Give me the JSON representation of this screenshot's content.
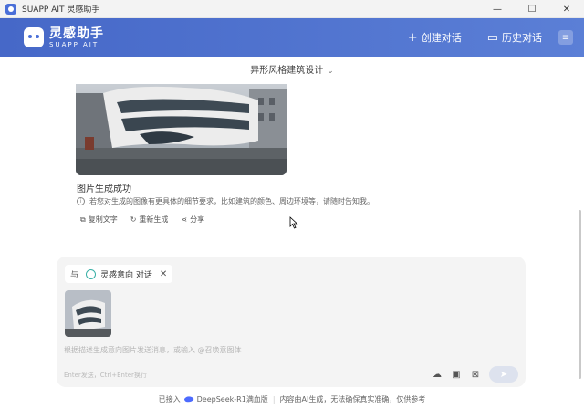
{
  "window": {
    "title": "SUAPP AIT 灵感助手",
    "minimize": "—",
    "maximize": "☐",
    "close": "✕"
  },
  "header": {
    "logo_cn": "灵感助手",
    "logo_en": "SUAPP AIT",
    "new_chat_icon": "+",
    "new_chat": "创建对话",
    "history_icon": "▭",
    "history": "历史对话",
    "menu_icon": "≡"
  },
  "mode": {
    "label": "异形风格建筑设计",
    "caret": "⌄"
  },
  "message": {
    "status": "图片生成成功",
    "hint": "若您对生成的图像有更具体的细节要求，比如建筑的颜色、周边环境等，请随时告知我。",
    "info_icon": "i",
    "actions": [
      {
        "icon": "⧉",
        "label": "复制文字"
      },
      {
        "icon": "↻",
        "label": "重新生成"
      },
      {
        "icon": "⋖",
        "label": "分享"
      }
    ]
  },
  "composer": {
    "with": "与",
    "agent": "灵感意向 对话",
    "close": "✕",
    "placeholder": "根据描述生成意向图片发送消息，或输入 @召唤意图体",
    "enter_hint": "Enter发送，Ctrl+Enter换行",
    "tools": {
      "upload": "☁",
      "image": "▣",
      "crop": "⊠"
    },
    "send_icon": "➤"
  },
  "footer": {
    "connected": "已接入",
    "model": "DeepSeek-R1满血版",
    "disclaimer": "内容由AI生成，无法确保真实准确，仅供参考",
    "sep": "|"
  },
  "colors": {
    "header_start": "#4668c8",
    "header_end": "#5b7fd6",
    "accent_teal": "#3ab0a6",
    "panel_bg": "#f4f4f4"
  }
}
